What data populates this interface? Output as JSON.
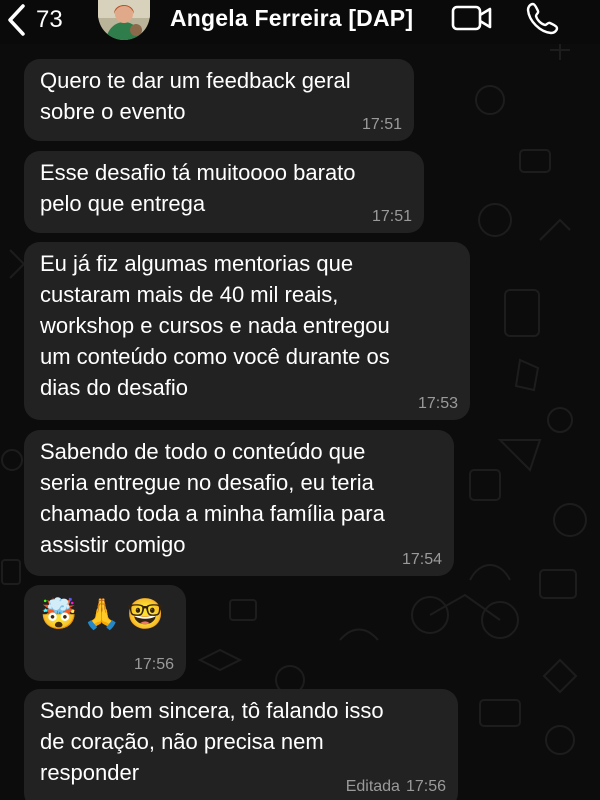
{
  "header": {
    "back_count": "73",
    "contact_name": "Angela Ferreira [DAP]"
  },
  "messages": [
    {
      "text": "Quero te dar um feedback geral\nsobre o evento",
      "time": "17:51"
    },
    {
      "text": "Esse desafio tá muitoooo barato\npelo que entrega",
      "time": "17:51"
    },
    {
      "text": "Eu já fiz algumas mentorias que\ncustaram mais de 40 mil reais,\nworkshop e cursos e nada entregou\num conteúdo como você durante os\ndias do desafio",
      "time": "17:53"
    },
    {
      "text": "Sabendo de todo o conteúdo que\nseria entregue no desafio, eu teria\nchamado toda a minha família para\nassistir comigo",
      "time": "17:54"
    },
    {
      "emojis": [
        "🤯",
        "🙏",
        "🤓"
      ],
      "time": "17:56"
    },
    {
      "text": "Sendo bem sincera, tô falando isso\nde coração, não precisa nem\nresponder",
      "edited_label": "Editada",
      "time": "17:56"
    }
  ],
  "icons": {
    "back": "chevron-left-icon",
    "video": "video-camera-icon",
    "call": "phone-icon"
  },
  "colors": {
    "background": "#0c0c0c",
    "bubble": "#222222",
    "text": "#ffffff",
    "timestamp": "#9a9a9a"
  }
}
